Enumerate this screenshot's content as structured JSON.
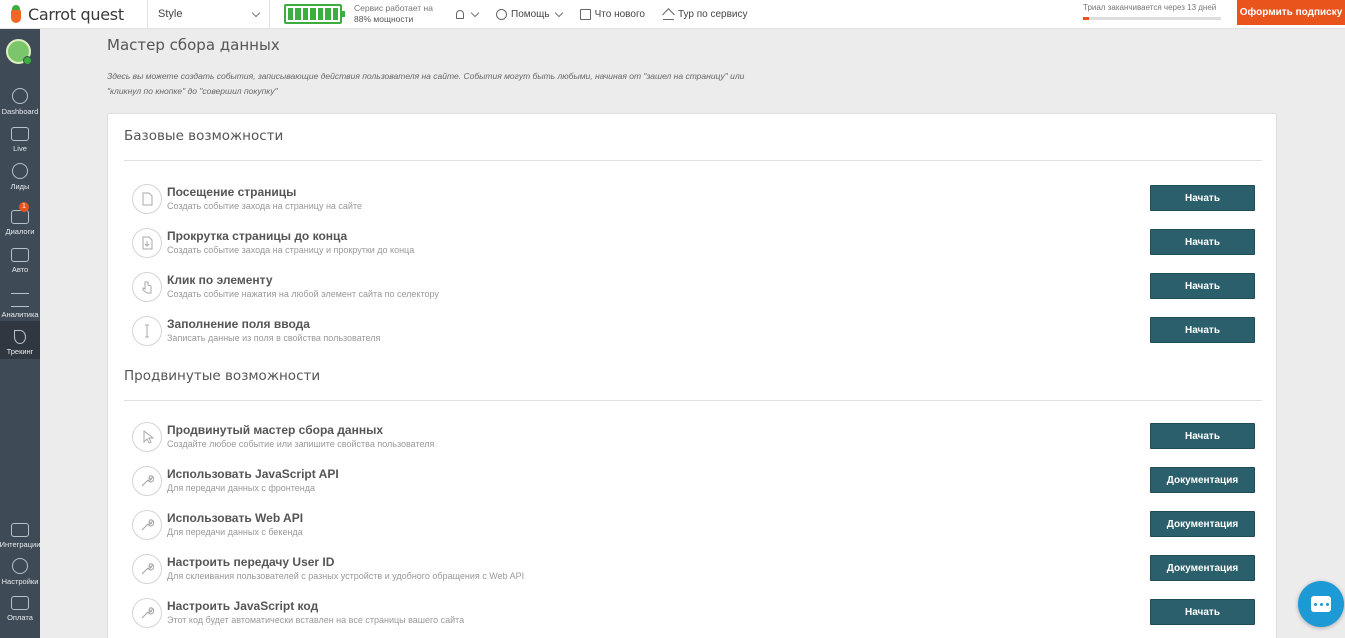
{
  "topbar": {
    "logo_text": "Carrot quest",
    "project": "Style",
    "service_status_line1": "Сервис работает на",
    "service_status_line2": "88% мощности",
    "service_capacity_percent": 88,
    "help_label": "Помощь",
    "whats_new_label": "Что нового",
    "tour_label": "Тур по сервису",
    "trial_text": "Триал заканчивается через 13 дней",
    "trial_progress": 0.04,
    "subscribe_label": "Оформить подписку"
  },
  "sidebar": {
    "items": [
      {
        "label": "Dashboard",
        "icon": "dashboard-icon"
      },
      {
        "label": "Live",
        "icon": "live-icon"
      },
      {
        "label": "Лиды",
        "icon": "leads-icon"
      },
      {
        "label": "Диалоги",
        "icon": "dialogs-icon",
        "badge": "1"
      },
      {
        "label": "Авто",
        "icon": "auto-icon"
      },
      {
        "label": "Аналитика",
        "icon": "analytics-icon"
      },
      {
        "label": "Трекинг",
        "icon": "tracking-icon",
        "active": true
      },
      {
        "label": "Интеграции",
        "icon": "integrations-icon"
      },
      {
        "label": "Настройки",
        "icon": "settings-icon"
      },
      {
        "label": "Оплата",
        "icon": "payment-icon"
      }
    ]
  },
  "main": {
    "title": "Мастер сбора данных",
    "description": "Здесь вы можете создать события, записывающие действия пользователя на сайте. События могут быть любыми, начиная от \"зашел на страницу\" или \"кликнул по кнопке\" до \"совершил покупку\"",
    "basic": {
      "title": "Базовые возможности",
      "rows": [
        {
          "title": "Посещение страницы",
          "subtitle": "Создать событие захода на страницу на сайте",
          "button": "Начать",
          "icon": "page-icon"
        },
        {
          "title": "Прокрутка страницы до конца",
          "subtitle": "Создать событие захода на страницу и прокрутки до конца",
          "button": "Начать",
          "icon": "scroll-icon"
        },
        {
          "title": "Клик по элементу",
          "subtitle": "Создать событие нажатия на любой элемент сайта по селектору",
          "button": "Начать",
          "icon": "click-icon"
        },
        {
          "title": "Заполнение поля ввода",
          "subtitle": "Записать данные из поля в свойства пользователя",
          "button": "Начать",
          "icon": "text-cursor-icon"
        }
      ]
    },
    "advanced": {
      "title": "Продвинутые возможности",
      "rows": [
        {
          "title": "Продвинутый мастер сбора данных",
          "subtitle": "Создайте любое событие или запишите свойства пользователя",
          "button": "Начать",
          "icon": "cursor-icon"
        },
        {
          "title": "Использовать JavaScript API",
          "subtitle": "Для передачи данных с фронтенда",
          "button": "Документация",
          "icon": "wrench-icon"
        },
        {
          "title": "Использовать Web API",
          "subtitle": "Для передачи данных с бекенда",
          "button": "Документация",
          "icon": "wrench-icon"
        },
        {
          "title": "Настроить передачу User ID",
          "subtitle": "Для склеивания пользователей с разных устройств и удобного обращения с Web API",
          "button": "Документация",
          "icon": "wrench-icon"
        },
        {
          "title": "Настроить JavaScript код",
          "subtitle": "Этот код будет автоматически вставлен на все страницы вашего сайта",
          "button": "Начать",
          "icon": "wrench-icon"
        }
      ]
    }
  },
  "colors": {
    "accent": "#e8541c",
    "button": "#2b5f6b",
    "sidebar": "#3e4a55",
    "battery": "#3cae3f",
    "chat": "#1d9ad6"
  }
}
